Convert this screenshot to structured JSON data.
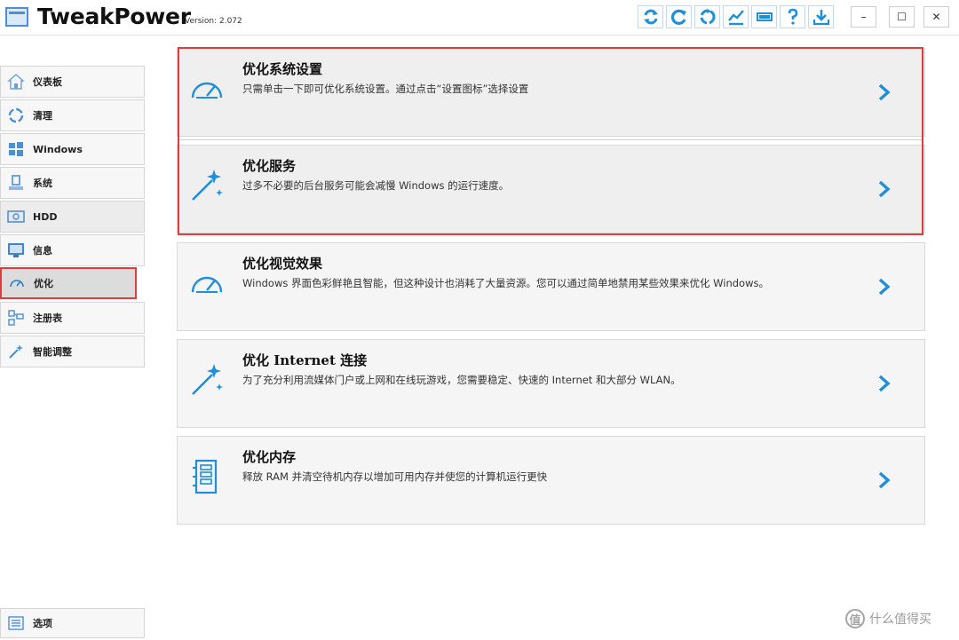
{
  "app": {
    "title": "TweakPower",
    "version": "Version: 2.072",
    "accent_color": "#1e8fd8",
    "highlight_color": "#e23b3b"
  },
  "toolbar": {
    "icons": [
      "refresh-icon",
      "reload-icon",
      "recycle-icon",
      "chart-icon",
      "battery-icon",
      "help-icon",
      "download-icon"
    ]
  },
  "window": {
    "minimize": "–",
    "maximize": "☐",
    "close": "✕"
  },
  "sidebar": {
    "items": [
      {
        "label": "仪表板",
        "icon": "home-icon"
      },
      {
        "label": "清理",
        "icon": "recycle-icon"
      },
      {
        "label": "Windows",
        "icon": "windows-icon"
      },
      {
        "label": "系统",
        "icon": "system-icon"
      },
      {
        "label": "HDD",
        "icon": "hdd-icon"
      },
      {
        "label": "信息",
        "icon": "monitor-icon"
      },
      {
        "label": "优化",
        "icon": "speedometer-icon",
        "active": true
      },
      {
        "label": "注册表",
        "icon": "registry-icon"
      },
      {
        "label": "智能调整",
        "icon": "wand-icon"
      }
    ],
    "options_label": "选项"
  },
  "cards": [
    {
      "title": "优化系统设置",
      "desc": "只需单击一下即可优化系统设置。通过点击“设置图标”选择设置",
      "icon": "speedometer-icon"
    },
    {
      "title": "优化服务",
      "desc": "过多不必要的后台服务可能会减慢 Windows 的运行速度。",
      "icon": "magic-wand-icon"
    },
    {
      "title": "优化视觉效果",
      "desc": "Windows 界面色彩鲜艳且智能，但这种设计也消耗了大量资源。您可以通过简单地禁用某些效果来优化 Windows。",
      "icon": "speedometer-icon"
    },
    {
      "title": "优化 Internet 连接",
      "desc": "为了充分利用流媒体门户或上网和在线玩游戏，您需要稳定、快速的 Internet 和大部分 WLAN。",
      "icon": "magic-wand-icon"
    },
    {
      "title": "优化内存",
      "desc": "释放 RAM 并清空待机内存以增加可用内存并使您的计算机运行更快",
      "icon": "memory-icon"
    }
  ],
  "watermark": {
    "symbol": "值",
    "text": "什么值得买"
  }
}
